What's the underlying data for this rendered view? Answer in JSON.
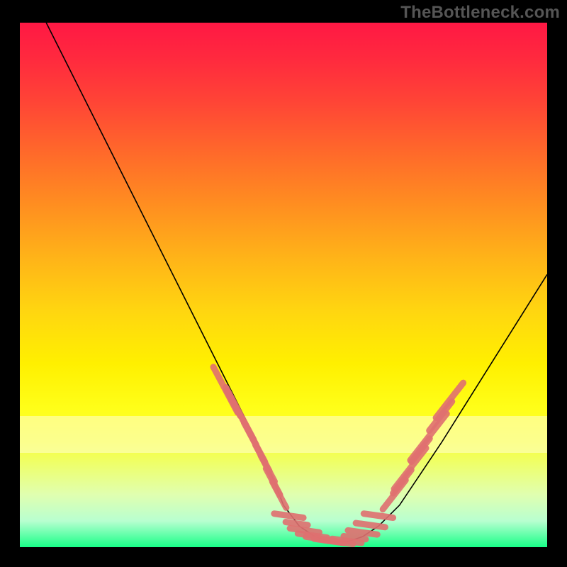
{
  "brand": "TheBottleneck.com",
  "colors": {
    "tick": "#e07070",
    "curve": "#000000",
    "frame": "#000000"
  },
  "chart_data": {
    "type": "line",
    "title": "",
    "xlabel": "",
    "ylabel": "",
    "xlim": [
      0,
      100
    ],
    "ylim": [
      0,
      100
    ],
    "grid": false,
    "legend": false,
    "highlight_band_y": [
      18,
      25
    ],
    "series": [
      {
        "name": "bottleneck-curve",
        "x": [
          5,
          10,
          15,
          20,
          25,
          30,
          35,
          40,
          45,
          48,
          50,
          53,
          56,
          59,
          62,
          65,
          68,
          72,
          76,
          80,
          85,
          90,
          95,
          100
        ],
        "y": [
          100,
          90,
          80,
          70,
          60,
          50,
          40,
          30,
          20,
          13,
          8,
          4,
          2,
          1,
          1,
          2,
          4,
          8,
          14,
          20,
          28,
          36,
          44,
          52
        ]
      }
    ],
    "ticks_left": {
      "comment": "salmon dash segments on the descending branch",
      "segments": [
        {
          "x": 39.0,
          "y": 30.0,
          "len": 3.5
        },
        {
          "x": 40.5,
          "y": 27.5,
          "len": 2.0
        },
        {
          "x": 41.7,
          "y": 25.5,
          "len": 4.0
        },
        {
          "x": 43.5,
          "y": 22.0,
          "len": 2.0
        },
        {
          "x": 44.5,
          "y": 20.0,
          "len": 3.0
        },
        {
          "x": 46.0,
          "y": 17.0,
          "len": 2.0
        },
        {
          "x": 47.0,
          "y": 15.0,
          "len": 2.0
        },
        {
          "x": 48.0,
          "y": 12.5,
          "len": 2.0
        },
        {
          "x": 49.2,
          "y": 10.0,
          "len": 2.0
        }
      ]
    },
    "ticks_bottom": {
      "comment": "salmon dash segments near the trough",
      "segments": [
        {
          "x": 51.0,
          "y": 6.0,
          "len": 2.0
        },
        {
          "x": 52.5,
          "y": 4.5,
          "len": 1.5
        },
        {
          "x": 54.0,
          "y": 3.2,
          "len": 2.0
        },
        {
          "x": 55.5,
          "y": 2.2,
          "len": 2.0
        },
        {
          "x": 57.0,
          "y": 1.6,
          "len": 2.0
        },
        {
          "x": 58.6,
          "y": 1.2,
          "len": 2.0
        },
        {
          "x": 60.4,
          "y": 1.0,
          "len": 2.0
        },
        {
          "x": 62.0,
          "y": 1.2,
          "len": 2.0
        },
        {
          "x": 63.5,
          "y": 1.8,
          "len": 1.5
        },
        {
          "x": 65.0,
          "y": 2.8,
          "len": 2.0
        },
        {
          "x": 66.5,
          "y": 4.2,
          "len": 2.0
        },
        {
          "x": 68.0,
          "y": 6.0,
          "len": 2.0
        }
      ]
    },
    "ticks_right": {
      "comment": "salmon dash segments on the ascending branch",
      "segments": [
        {
          "x": 71.0,
          "y": 10.0,
          "len": 2.5
        },
        {
          "x": 72.5,
          "y": 12.5,
          "len": 2.0
        },
        {
          "x": 74.0,
          "y": 15.0,
          "len": 3.5
        },
        {
          "x": 76.0,
          "y": 18.5,
          "len": 2.0
        },
        {
          "x": 77.5,
          "y": 21.0,
          "len": 4.0
        },
        {
          "x": 79.8,
          "y": 25.0,
          "len": 2.5
        },
        {
          "x": 81.5,
          "y": 28.0,
          "len": 3.0
        }
      ]
    }
  }
}
